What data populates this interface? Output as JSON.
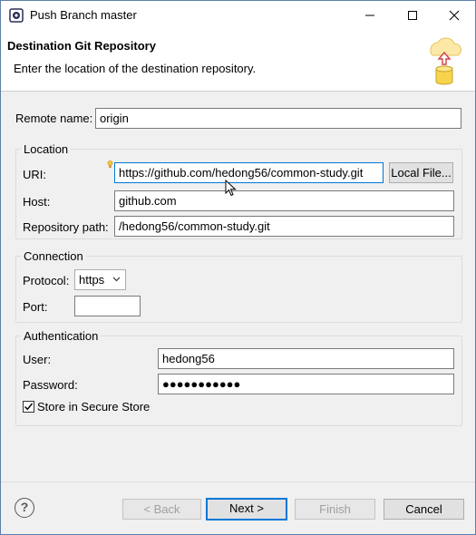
{
  "window": {
    "title": "Push Branch master"
  },
  "banner": {
    "title": "Destination Git Repository",
    "description": "Enter the location of the destination repository."
  },
  "remote": {
    "label": "Remote name:",
    "value": "origin"
  },
  "location": {
    "group_title": "Location",
    "uri_label": "URI:",
    "uri_value": "https://github.com/hedong56/common-study.git",
    "local_file_button": "Local File...",
    "host_label": "Host:",
    "host_value": "github.com",
    "repo_path_label": "Repository path:",
    "repo_path_value": "/hedong56/common-study.git"
  },
  "connection": {
    "group_title": "Connection",
    "protocol_label": "Protocol:",
    "protocol_value": "https",
    "port_label": "Port:",
    "port_value": ""
  },
  "authentication": {
    "group_title": "Authentication",
    "user_label": "User:",
    "user_value": "hedong56",
    "password_label": "Password:",
    "password_value": "●●●●●●●●●●●",
    "store_label": "Store in Secure Store",
    "store_checked": true
  },
  "footer": {
    "back_button": "< Back",
    "next_button": "Next >",
    "finish_button": "Finish",
    "cancel_button": "Cancel",
    "help_icon": "?"
  },
  "colors": {
    "focus_accent": "#0078d7",
    "banner_bg": "#ffffff",
    "dialog_bg": "#f0f0f0"
  },
  "icons": {
    "app": "eclipse-gear-icon",
    "banner": "cloud-push-icon",
    "help": "help-icon",
    "decoration": "content-assist-bulb-icon"
  }
}
